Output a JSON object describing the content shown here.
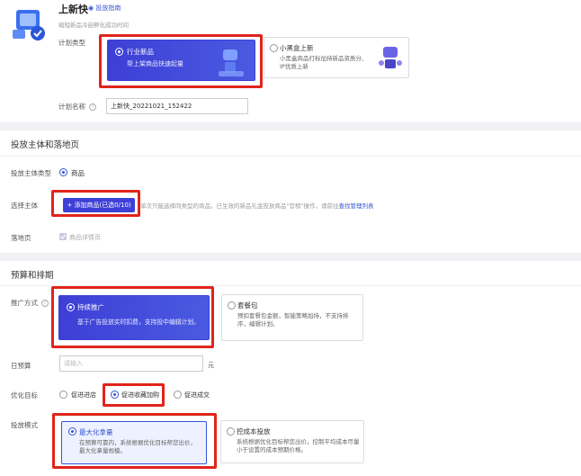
{
  "header": {
    "title": "上新快",
    "guide_link": "投放指南",
    "subtitle": "缩短新品冷启孵化成功时间"
  },
  "plan_type": {
    "label": "计划类型",
    "options": [
      {
        "title": "行业新品",
        "desc": "帮上架商品快速起量",
        "selected": true
      },
      {
        "title": "小黑盒上新",
        "desc": "小黑盒商品打标加持新品资质分、IP优质上新",
        "selected": false
      }
    ]
  },
  "plan_name": {
    "label": "计划名称",
    "value": "上新快_20221021_152422"
  },
  "subject_section": {
    "title": "投放主体和落地页",
    "subject_type_label": "投放主体类型",
    "subject_type_value": "商品",
    "select_subject_label": "选择主体",
    "add_goods_button": "+ 添加商品(已选0/10)",
    "add_goods_hint": "单次只能选择同类型的商品，已生效的新品礼金投放商品",
    "add_goods_hint_tail": "\"官榜\"操作，请前往",
    "add_goods_link": "查找管理列表",
    "landing_label": "落地页",
    "landing_value": "商品详情页"
  },
  "budget_section": {
    "title": "预算和排期",
    "promo_label": "推广方式",
    "promo_options": [
      {
        "title": "持续推广",
        "desc": "基于广告投放实时扣费，支持投中编辑计划。",
        "selected": true
      },
      {
        "title": "套餐包",
        "desc": "预扣套餐包金额，智能策略加持，不支持排序，编辑计划。",
        "selected": false
      }
    ],
    "daily_budget_label": "日预算",
    "daily_budget_placeholder": "请输入",
    "daily_budget_unit": "元",
    "goal_label": "优化目标",
    "goal_options": [
      {
        "label": "促进进店",
        "selected": false
      },
      {
        "label": "促进收藏加购",
        "selected": true
      },
      {
        "label": "促进成交",
        "selected": false
      }
    ],
    "bid_label": "投放模式",
    "bid_options": [
      {
        "title": "最大化拿量",
        "desc": "在预算可靠内，系统根据优化目标帮您出价，最大化拿量规模。",
        "selected": true
      },
      {
        "title": "控成本投放",
        "desc": "系统根据优化目标帮您出价，控制平均成本尽量小于设置的成本预期价格。",
        "selected": false
      }
    ]
  },
  "colors": {
    "accent": "#3355d4",
    "selected_card": "#3d3fd6",
    "highlight_red": "#e0241b"
  }
}
